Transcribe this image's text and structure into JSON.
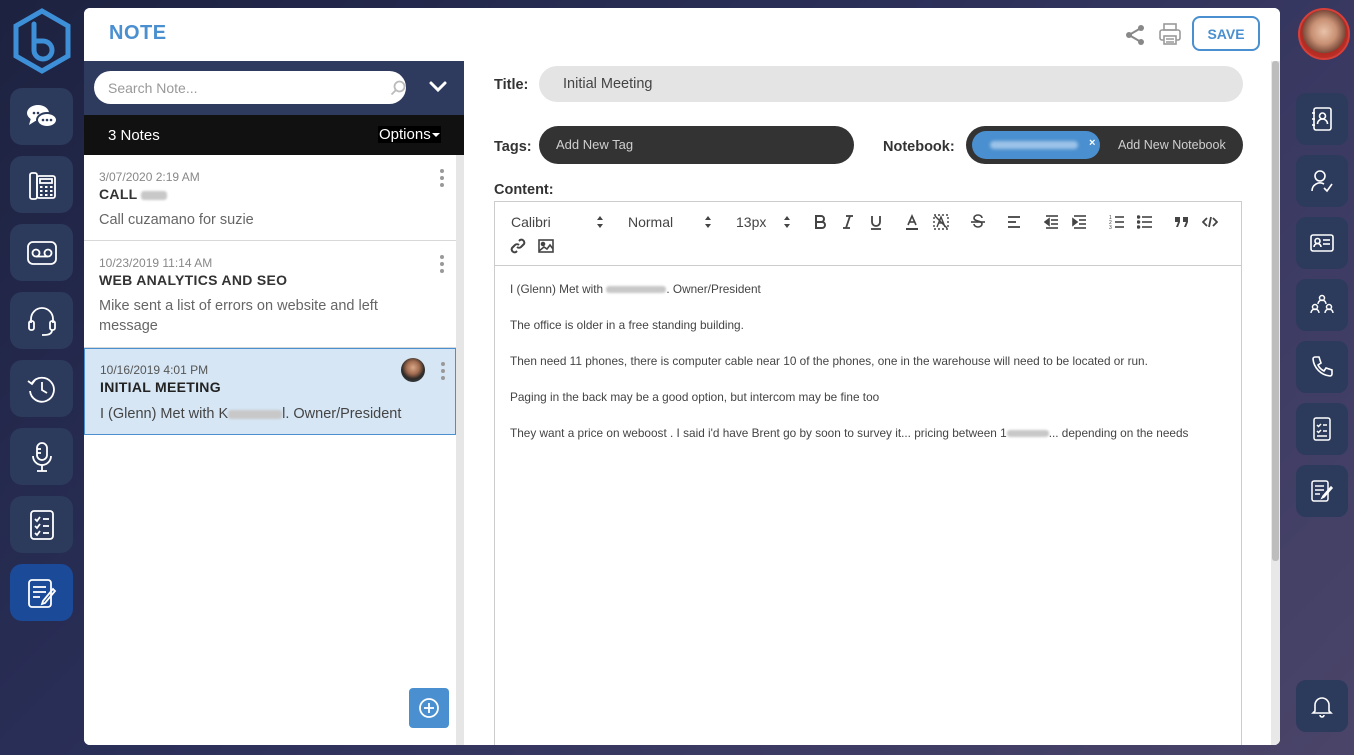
{
  "page": {
    "title": "NOTE"
  },
  "toolbar": {
    "save_label": "SAVE"
  },
  "search": {
    "placeholder": "Search Note..."
  },
  "notes_header": {
    "count": "3 Notes",
    "options": "Options"
  },
  "notes": [
    {
      "date": "3/07/2020 2:19 AM",
      "title": "CALL",
      "snippet": "Call cuzamano for suzie"
    },
    {
      "date": "10/23/2019 11:14 AM",
      "title": "WEB ANALYTICS AND SEO",
      "snippet": "Mike sent a list of errors on website and left message"
    },
    {
      "date": "10/16/2019 4:01 PM",
      "title": "INITIAL MEETING",
      "snippet_a": "I (Glenn) Met with K",
      "snippet_b": "l. Owner/President"
    }
  ],
  "editor": {
    "title_label": "Title:",
    "title_value": "Initial Meeting",
    "tags_label": "Tags:",
    "tags_placeholder": "Add New Tag",
    "notebook_label": "Notebook:",
    "notebook_chip_close": "×",
    "notebook_placeholder": "Add New Notebook",
    "content_label": "Content:",
    "font_family": "Calibri",
    "font_style": "Normal",
    "font_size": "13px",
    "content": {
      "line1_a": "I (Glenn) Met with ",
      "line1_b": ". Owner/President",
      "line2": "The office is older in a free standing building.",
      "line3": "Then need 11 phones, there is computer cable near 10 of the phones, one in the warehouse will need to be located or run.",
      "line4": "Paging in the back may be a good option, but intercom may be fine too",
      "line5_a": "They want a price on weboost .  I said i'd have Brent go by soon to survey it... pricing between 1",
      "line5_b": "... depending on the needs"
    }
  },
  "colors": {
    "accent": "#4a8fcf",
    "rail_bg": "#2c3a5c",
    "rail_active": "#1b4a99",
    "dark_field": "#333333"
  }
}
